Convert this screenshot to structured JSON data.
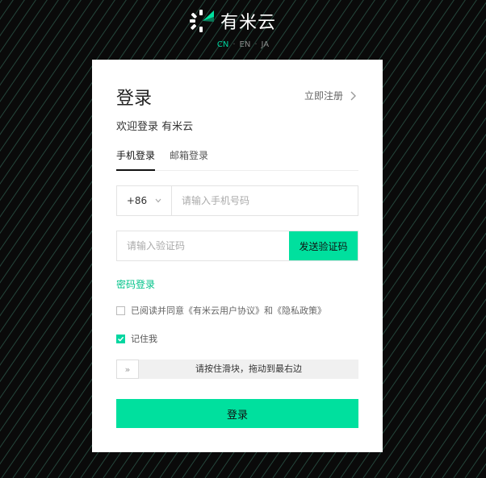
{
  "brand": {
    "name": "有米云",
    "accent": "#00e09e"
  },
  "languages": [
    {
      "code": "CN",
      "active": true
    },
    {
      "code": "EN",
      "active": false
    },
    {
      "code": "JA",
      "active": false
    }
  ],
  "card": {
    "title": "登录",
    "register_link": "立即注册",
    "welcome": "欢迎登录 有米云",
    "tabs": [
      {
        "label": "手机登录",
        "active": true
      },
      {
        "label": "邮箱登录",
        "active": false
      }
    ],
    "phone": {
      "country_code": "+86",
      "placeholder": "请输入手机号码",
      "value": ""
    },
    "code": {
      "placeholder": "请输入验证码",
      "value": "",
      "send_label": "发送验证码"
    },
    "password_login_link": "密码登录",
    "agreement": {
      "text": "已阅读并同意《有米云用户协议》和《隐私政策》",
      "checked": false
    },
    "remember": {
      "label": "记住我",
      "checked": true
    },
    "slider": {
      "text": "请按住滑块，拖动到最右边",
      "handle_glyph": "»"
    },
    "submit_label": "登录"
  }
}
